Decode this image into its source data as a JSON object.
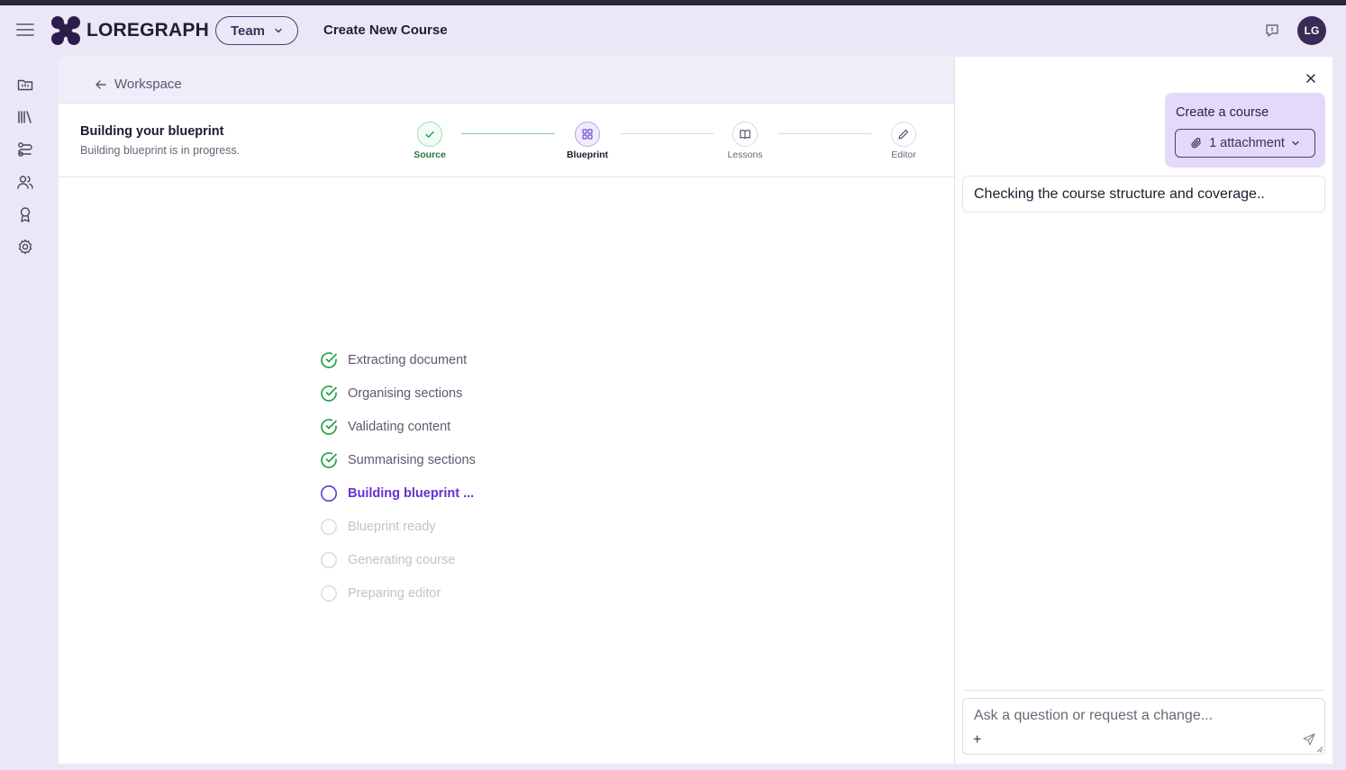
{
  "header": {
    "brand": "LOREGRAPH",
    "team_label": "Team",
    "page_title": "Create New Course",
    "avatar_initials": "LG"
  },
  "breadcrumb": {
    "label": "Workspace"
  },
  "stepper_header": {
    "title": "Building your blueprint",
    "subtitle": "Building blueprint is in progress."
  },
  "steps": [
    {
      "label": "Source",
      "state": "done"
    },
    {
      "label": "Blueprint",
      "state": "active"
    },
    {
      "label": "Lessons",
      "state": "pending"
    },
    {
      "label": "Editor",
      "state": "pending"
    }
  ],
  "progress": [
    {
      "label": "Extracting document",
      "state": "done"
    },
    {
      "label": "Organising sections",
      "state": "done"
    },
    {
      "label": "Validating content",
      "state": "done"
    },
    {
      "label": "Summarising sections",
      "state": "done"
    },
    {
      "label": "Building blueprint ...",
      "state": "active"
    },
    {
      "label": "Blueprint ready",
      "state": "pending"
    },
    {
      "label": "Generating course",
      "state": "pending"
    },
    {
      "label": "Preparing editor",
      "state": "pending"
    }
  ],
  "chat": {
    "user_message": "Create a course",
    "attachment_label": "1 attachment",
    "assistant_message": "Checking the course structure and coverage..",
    "input_placeholder": "Ask a question or request a change...",
    "plus_label": "+"
  },
  "colors": {
    "accent": "#6a2fd1",
    "success": "#22a046",
    "background": "#ece7f7"
  }
}
